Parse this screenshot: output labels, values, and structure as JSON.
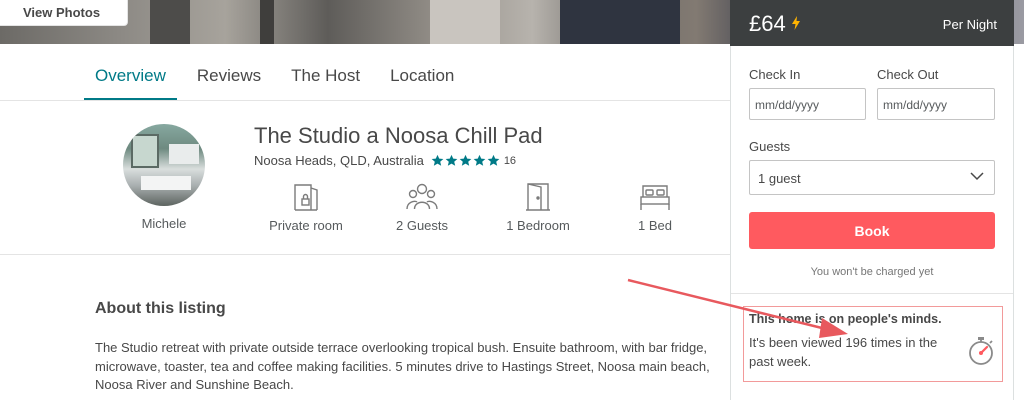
{
  "hero": {
    "view_photos": "View Photos"
  },
  "tabs": [
    {
      "label": "Overview",
      "active": true
    },
    {
      "label": "Reviews",
      "active": false
    },
    {
      "label": "The Host",
      "active": false
    },
    {
      "label": "Location",
      "active": false
    }
  ],
  "listing": {
    "title": "The Studio a Noosa Chill Pad",
    "location": "Noosa Heads, QLD, Australia",
    "rating_stars": 5,
    "review_count": "16",
    "host_name": "Michele",
    "amenities": [
      {
        "icon": "private-room-icon",
        "label": "Private room"
      },
      {
        "icon": "guests-icon",
        "label": "2 Guests"
      },
      {
        "icon": "bedroom-door-icon",
        "label": "1 Bedroom"
      },
      {
        "icon": "bed-icon",
        "label": "1 Bed"
      }
    ]
  },
  "about": {
    "heading": "About this listing",
    "text": "The Studio retreat with private outside terrace overlooking tropical bush. Ensuite bathroom, with bar fridge, microwave, toaster, tea and coffee making facilities. 5 minutes drive to Hastings Street, Noosa main beach, Noosa River and Sunshine Beach."
  },
  "booking": {
    "price": "£64",
    "per_night": "Per Night",
    "check_in_label": "Check In",
    "check_in_placeholder": "mm/dd/yyyy",
    "check_out_label": "Check Out",
    "check_out_placeholder": "mm/dd/yyyy",
    "guests_label": "Guests",
    "guests_value": "1 guest",
    "book_label": "Book",
    "no_charge": "You won't be charged yet",
    "mind_heading": "This home is on people's minds.",
    "mind_text": "It's been viewed 196 times in the past week."
  },
  "colors": {
    "accent": "#007a87",
    "book_button": "#ff5a5f",
    "price_bar": "#3c3f40",
    "highlight_border": "#f29a9a",
    "arrow": "#e8595e"
  }
}
